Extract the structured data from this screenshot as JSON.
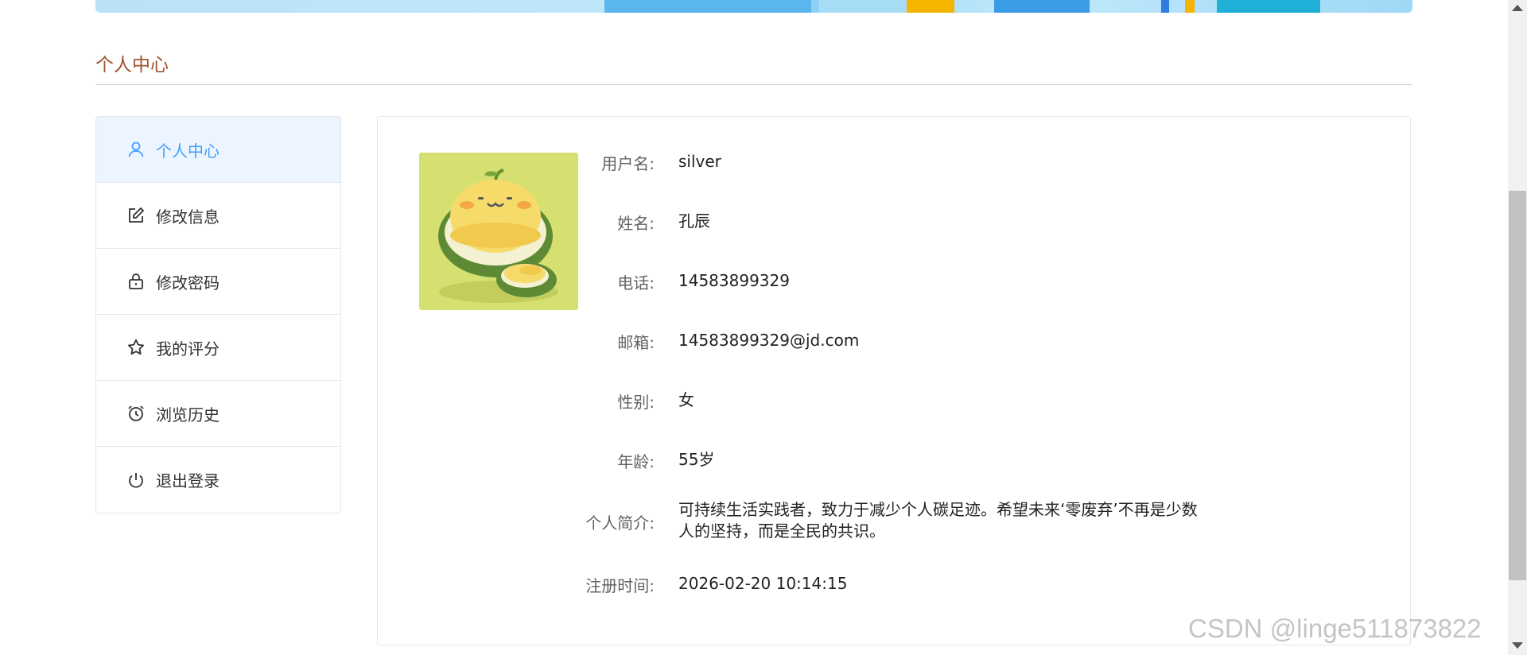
{
  "page": {
    "heading": "个人中心",
    "accent_color": "#409eff",
    "heading_color": "#a0522d"
  },
  "sidebar": {
    "items": [
      {
        "label": "个人中心",
        "icon": "user-icon",
        "active": true
      },
      {
        "label": "修改信息",
        "icon": "edit-icon",
        "active": false
      },
      {
        "label": "修改密码",
        "icon": "lock-icon",
        "active": false
      },
      {
        "label": "我的评分",
        "icon": "star-icon",
        "active": false
      },
      {
        "label": "浏览历史",
        "icon": "alarm-clock-icon",
        "active": false
      },
      {
        "label": "退出登录",
        "icon": "power-icon",
        "active": false
      }
    ]
  },
  "profile": {
    "avatar_icon": "durian-avatar-icon",
    "fields": [
      {
        "label": "用户名:",
        "value": "silver"
      },
      {
        "label": "姓名:",
        "value": "孔辰"
      },
      {
        "label": "电话:",
        "value": "14583899329"
      },
      {
        "label": "邮箱:",
        "value": "14583899329@jd.com"
      },
      {
        "label": "性别:",
        "value": "女"
      },
      {
        "label": "年龄:",
        "value": "55岁"
      },
      {
        "label": "个人简介:",
        "value": "可持续生活实践者，致力于减少个人碳足迹。希望未来‘零废弃’不再是少数人的坚持，而是全民的共识。"
      },
      {
        "label": "注册时间:",
        "value": "2026-02-20 10:14:15"
      }
    ]
  },
  "watermark": "CSDN @linge511873822"
}
